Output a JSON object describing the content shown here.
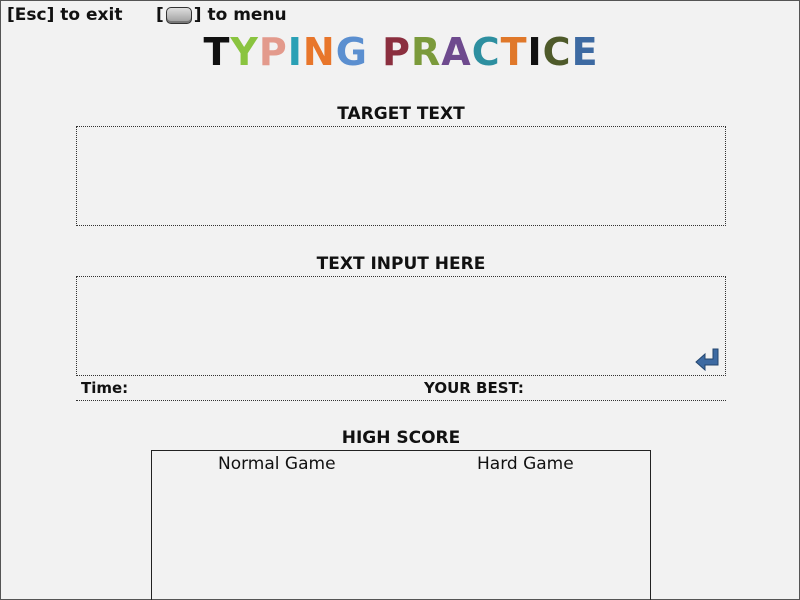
{
  "hints": {
    "exit_text": "[Esc] to exit",
    "menu_open_bracket": "[",
    "menu_text": "] to menu"
  },
  "title": {
    "letters": [
      {
        "char": "T",
        "color": "#111111"
      },
      {
        "char": "Y",
        "color": "#8ac43f"
      },
      {
        "char": "P",
        "color": "#e39a8c"
      },
      {
        "char": "I",
        "color": "#2aa0b5"
      },
      {
        "char": "N",
        "color": "#e8762b"
      },
      {
        "char": "G",
        "color": "#5b8fd0"
      },
      {
        "char": " ",
        "color": "#111111"
      },
      {
        "char": "P",
        "color": "#8b2f3f"
      },
      {
        "char": "R",
        "color": "#7b9a3b"
      },
      {
        "char": "A",
        "color": "#6e4a8e"
      },
      {
        "char": "C",
        "color": "#2d8fa0"
      },
      {
        "char": "T",
        "color": "#e0782a"
      },
      {
        "char": "I",
        "color": "#111111"
      },
      {
        "char": "C",
        "color": "#4e5a2a"
      },
      {
        "char": "E",
        "color": "#3d6aa2"
      }
    ]
  },
  "target": {
    "label": "TARGET TEXT",
    "text": ""
  },
  "input": {
    "label": "TEXT INPUT HERE",
    "value": ""
  },
  "stats": {
    "time_label": "Time:",
    "best_label": "YOUR BEST:"
  },
  "high_score": {
    "label": "HIGH SCORE",
    "normal_label": "Normal Game",
    "hard_label": "Hard Game"
  },
  "colors": {
    "background": "#f2f2f2",
    "enter_icon": "#3d6aa2"
  },
  "icons": {
    "menu_key": "keyboard-key-icon",
    "enter": "enter-return-icon"
  }
}
